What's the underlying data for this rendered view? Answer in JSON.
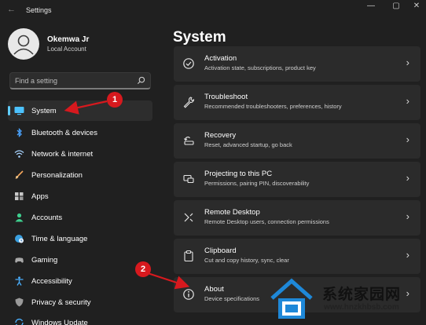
{
  "window": {
    "title": "Settings",
    "back_glyph": "←",
    "minimize_glyph": "—",
    "maximize_glyph": "▢",
    "close_glyph": "✕"
  },
  "account": {
    "name": "Okemwa Jr",
    "type": "Local Account"
  },
  "search": {
    "placeholder": "Find a setting"
  },
  "sidebar": {
    "items": [
      {
        "label": "System",
        "icon": "monitor-icon",
        "selected": true
      },
      {
        "label": "Bluetooth & devices",
        "icon": "bluetooth-icon"
      },
      {
        "label": "Network & internet",
        "icon": "wifi-icon"
      },
      {
        "label": "Personalization",
        "icon": "brush-icon"
      },
      {
        "label": "Apps",
        "icon": "apps-icon"
      },
      {
        "label": "Accounts",
        "icon": "person-icon"
      },
      {
        "label": "Time & language",
        "icon": "globe-clock-icon"
      },
      {
        "label": "Gaming",
        "icon": "gamepad-icon"
      },
      {
        "label": "Accessibility",
        "icon": "accessibility-icon"
      },
      {
        "label": "Privacy & security",
        "icon": "shield-icon"
      },
      {
        "label": "Windows Update",
        "icon": "update-icon"
      }
    ]
  },
  "main": {
    "title": "System",
    "cards": [
      {
        "title": "Activation",
        "subtitle": "Activation state, subscriptions, product key",
        "icon": "check-circle-icon"
      },
      {
        "title": "Troubleshoot",
        "subtitle": "Recommended troubleshooters, preferences, history",
        "icon": "wrench-icon"
      },
      {
        "title": "Recovery",
        "subtitle": "Reset, advanced startup, go back",
        "icon": "recovery-icon"
      },
      {
        "title": "Projecting to this PC",
        "subtitle": "Permissions, pairing PIN, discoverability",
        "icon": "projector-icon"
      },
      {
        "title": "Remote Desktop",
        "subtitle": "Remote Desktop users, connection permissions",
        "icon": "remote-desktop-icon"
      },
      {
        "title": "Clipboard",
        "subtitle": "Cut and copy history, sync, clear",
        "icon": "clipboard-icon"
      },
      {
        "title": "About",
        "subtitle": "Device specifications",
        "icon": "info-icon"
      }
    ],
    "chevron": "›"
  },
  "annotations": {
    "callout_1": "1",
    "callout_2": "2",
    "color": "#d7191e"
  },
  "watermark": {
    "text": "系统家园网",
    "url": "www.hnzkhbsb.com"
  },
  "colors": {
    "background": "#202020",
    "card": "#2b2b2b",
    "accent": "#60cdff",
    "callout": "#d7191e"
  }
}
